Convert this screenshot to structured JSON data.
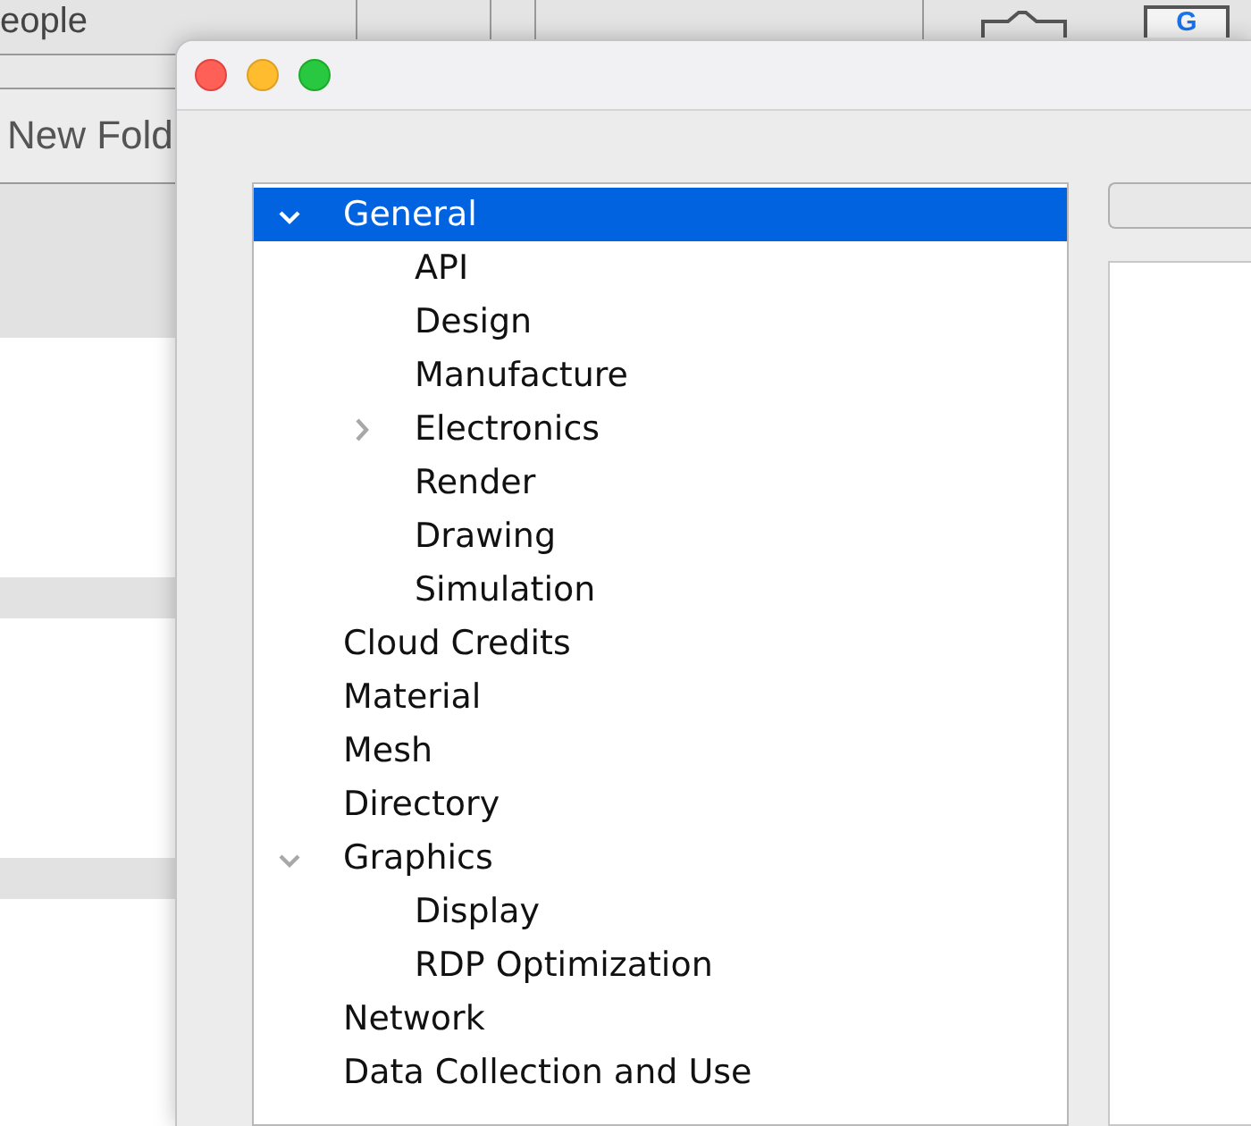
{
  "background_app": {
    "header_cell": "eople",
    "folder_button": "New Fold",
    "account_badge": "G"
  },
  "dialog": {
    "tree": [
      {
        "label": "General",
        "selected": true,
        "expanded": true,
        "children": [
          {
            "label": "API",
            "selected": false
          },
          {
            "label": "Design",
            "selected": false
          },
          {
            "label": "Manufacture",
            "selected": false
          },
          {
            "label": "Electronics",
            "selected": false,
            "expanded": false
          },
          {
            "label": "Render",
            "selected": false
          },
          {
            "label": "Drawing",
            "selected": false
          },
          {
            "label": "Simulation",
            "selected": false
          }
        ]
      },
      {
        "label": "Cloud Credits",
        "selected": false
      },
      {
        "label": "Material",
        "selected": false
      },
      {
        "label": "Mesh",
        "selected": false
      },
      {
        "label": "Directory",
        "selected": false
      },
      {
        "label": "Graphics",
        "selected": false,
        "expanded": true,
        "children": [
          {
            "label": "Display",
            "selected": false
          },
          {
            "label": "RDP Optimization",
            "selected": false
          }
        ]
      },
      {
        "label": "Network",
        "selected": false
      },
      {
        "label": "Data Collection and Use",
        "selected": false
      }
    ]
  }
}
